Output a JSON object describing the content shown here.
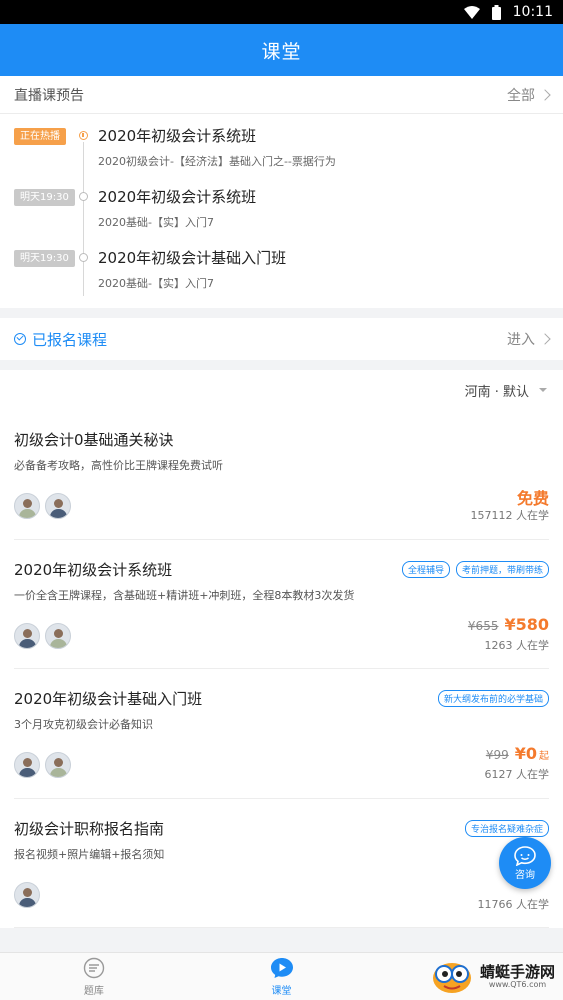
{
  "status_bar": {
    "time": "10:11"
  },
  "app_bar": {
    "title": "课堂"
  },
  "live": {
    "header": "直播课预告",
    "more": "全部",
    "items": [
      {
        "badge": "正在热播",
        "title": "2020年初级会计系统班",
        "subtitle": "2020初级会计-【经济法】基础入门之--票据行为"
      },
      {
        "badge": "明天19:30",
        "title": "2020年初级会计系统班",
        "subtitle": "2020基础-【实】入门7"
      },
      {
        "badge": "明天19:30",
        "title": "2020年初级会计基础入门班",
        "subtitle": "2020基础-【实】入门7"
      }
    ]
  },
  "enrolled": {
    "label": "已报名课程",
    "more": "进入"
  },
  "filter": {
    "label": "河南 · 默认"
  },
  "courses": [
    {
      "title": "初级会计0基础通关秘诀",
      "desc": "必备备考攻略，高性价比王牌课程免费试听",
      "tags": [],
      "old_price": "",
      "price": "免费",
      "suffix": "",
      "learners": "157112 人在学"
    },
    {
      "title": "2020年初级会计系统班",
      "desc": "一价全含王牌课程，含基础班+精讲班+冲刺班，全程8本教材3次发货",
      "tags": [
        "全程辅导",
        "考前押题，带刷带练"
      ],
      "old_price": "¥655",
      "price": "¥580",
      "suffix": "",
      "learners": "1263 人在学"
    },
    {
      "title": "2020年初级会计基础入门班",
      "desc": "3个月攻克初级会计必备知识",
      "tags": [
        "新大纲发布前的必学基础"
      ],
      "old_price": "¥99",
      "price": "¥0",
      "suffix": "起",
      "learners": "6127 人在学"
    },
    {
      "title": "初级会计职称报名指南",
      "desc": "报名视频+照片编辑+报名须知",
      "tags": [
        "专治报名疑难杂症"
      ],
      "old_price": "",
      "price": "",
      "suffix": "",
      "learners": "11766 人在学"
    }
  ],
  "consult": {
    "label": "咨询"
  },
  "tabs": [
    {
      "label": "题库",
      "icon": "question-bank-icon"
    },
    {
      "label": "课堂",
      "icon": "classroom-play-icon"
    }
  ],
  "watermark": {
    "name": "蜻蜓手游网",
    "url": "www.QT6.com"
  },
  "colors": {
    "primary": "#1e8cf5",
    "accent": "#f47a2d",
    "hot_badge": "#f6a04a"
  }
}
